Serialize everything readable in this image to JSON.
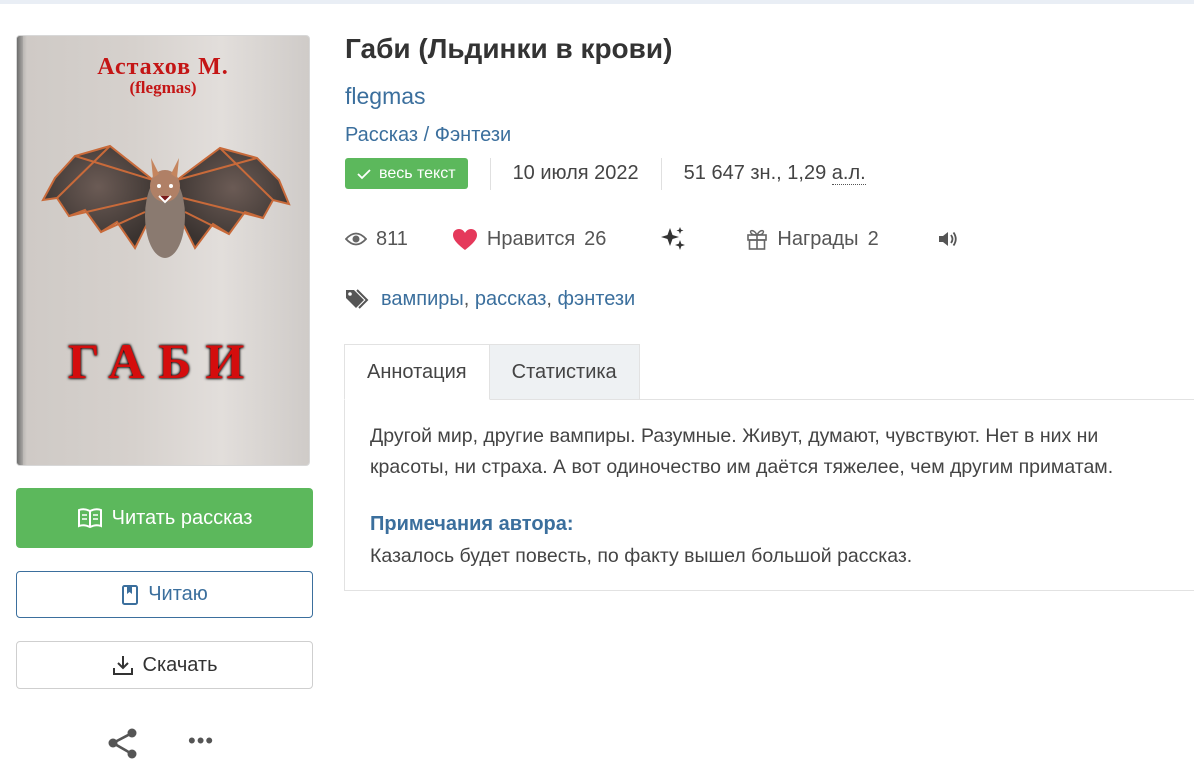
{
  "cover": {
    "author_line1": "Астахов М.",
    "author_line2": "(flegmas)",
    "big_title": "ГАБИ"
  },
  "buttons": {
    "read": "Читать рассказ",
    "reading": "Читаю",
    "download": "Скачать",
    "more": "•••"
  },
  "book": {
    "title": "Габи (Льдинки в крови)",
    "author": "flegmas",
    "form": "Рассказ",
    "genre_separator": "/",
    "genre": "Фэнтези",
    "badge": "весь текст",
    "date": "10 июля 2022",
    "size_chars": "51 647 зн., 1,29",
    "size_unit": "а.л."
  },
  "stats": {
    "views": "811",
    "likes_label": "Нравится",
    "likes": "26",
    "awards_label": "Награды",
    "awards": "2"
  },
  "tags": [
    "вампиры",
    "рассказ",
    "фэнтези"
  ],
  "tag_separator": ",",
  "tabs": [
    "Аннотация",
    "Статистика"
  ],
  "annotation": {
    "text": "Другой мир, другие вампиры. Разумные. Живут, думают, чувствуют. Нет в них ни красоты, ни страха. А вот одиночество им даётся тяжелее, чем другим приматам.",
    "notes_title": "Примечания автора:",
    "notes_text": "Казалось будет повесть, по факту вышел большой рассказ."
  },
  "colors": {
    "accent_blue": "#3b6f9d",
    "green": "#5cb85c",
    "heart": "#e5395b",
    "cover_title_red": "#d40d0d"
  }
}
